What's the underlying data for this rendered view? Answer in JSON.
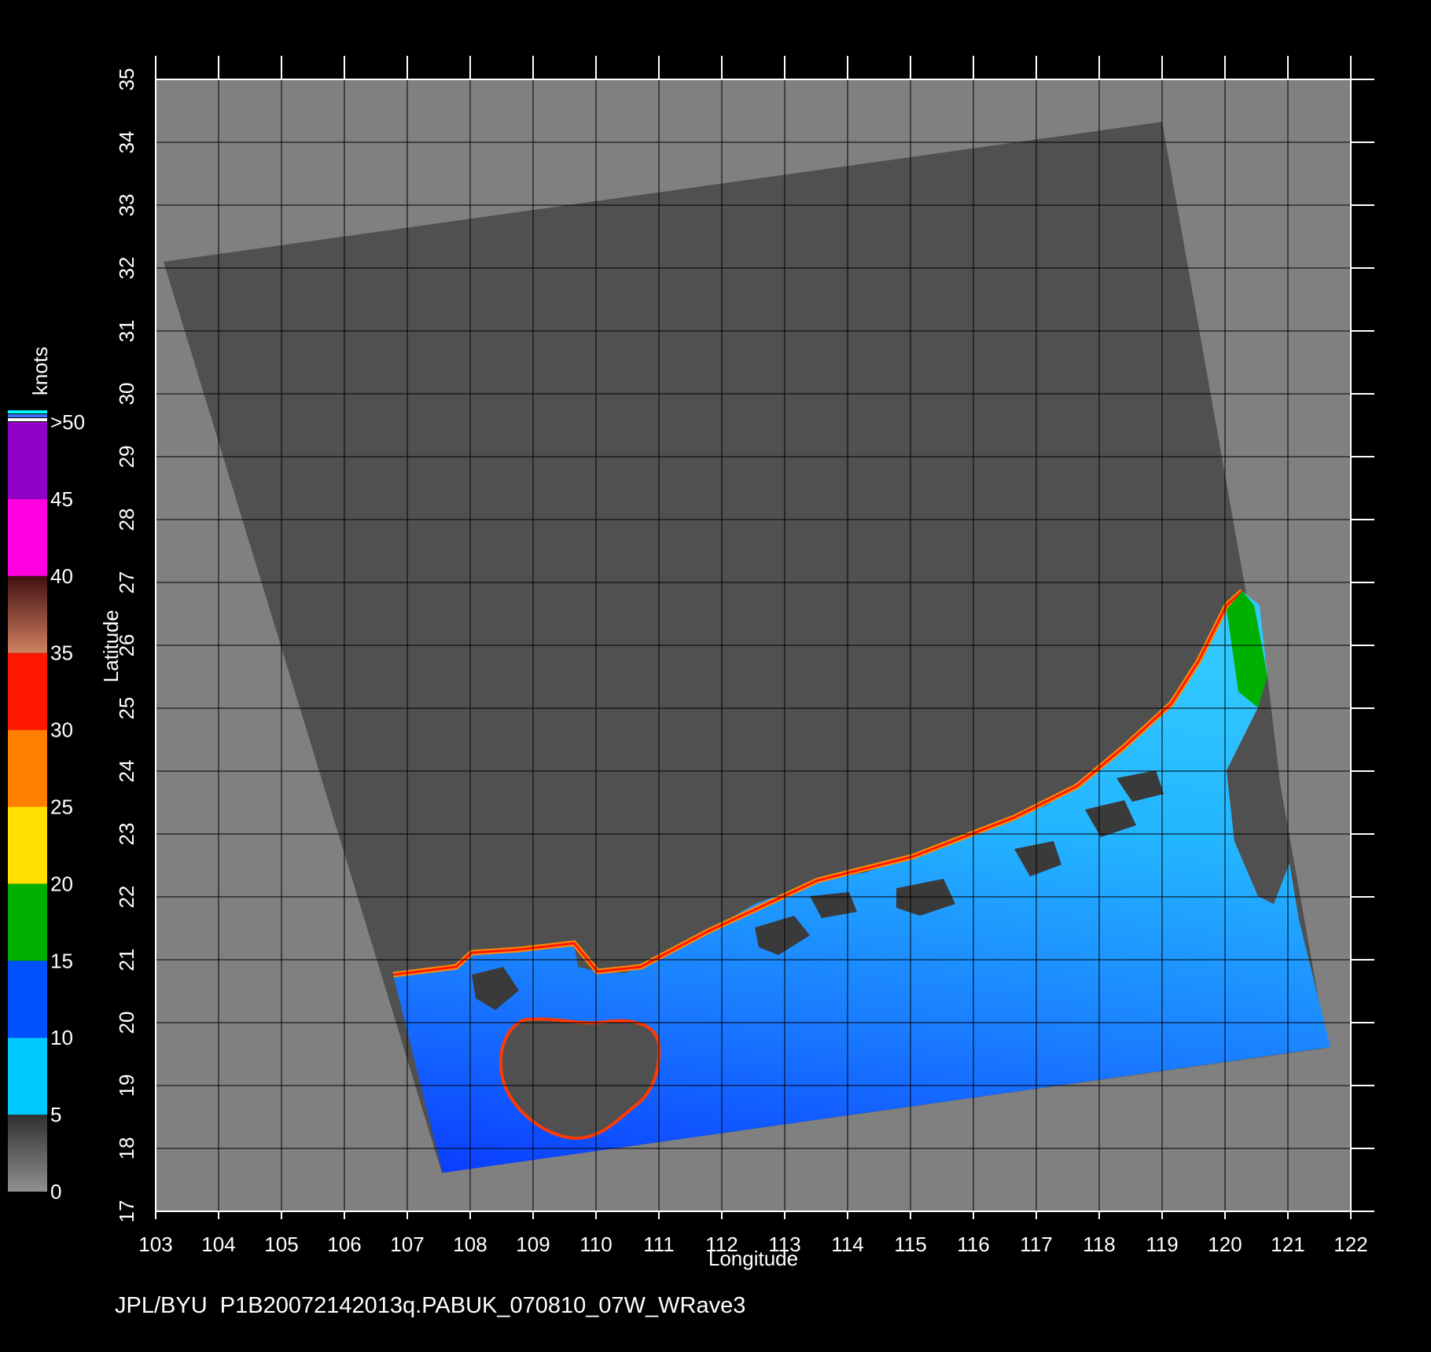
{
  "map": {
    "x_label": "Longitude",
    "y_label": "Latitude",
    "lon_ticks": [
      "103",
      "104",
      "105",
      "106",
      "107",
      "108",
      "109",
      "110",
      "111",
      "112",
      "113",
      "114",
      "115",
      "116",
      "117",
      "118",
      "119",
      "120",
      "121",
      "122"
    ],
    "lat_ticks": [
      "17",
      "18",
      "19",
      "20",
      "21",
      "22",
      "23",
      "24",
      "25",
      "26",
      "27",
      "28",
      "29",
      "30",
      "31",
      "32",
      "33",
      "34",
      "35"
    ],
    "lon_range": [
      103,
      122
    ],
    "lat_range": [
      17,
      35
    ],
    "background_color": "#808080",
    "swath_color": "#505050"
  },
  "colorbar": {
    "unit": "knots",
    "labels": [
      "0",
      "5",
      "10",
      "15",
      "20",
      "25",
      "30",
      "35",
      "40",
      "45",
      ">50"
    ],
    "bands": [
      {
        "from": 0,
        "to": 5,
        "color": "#606060"
      },
      {
        "from": 5,
        "to": 10,
        "color": "#00c8ff"
      },
      {
        "from": 10,
        "to": 15,
        "color": "#0050ff"
      },
      {
        "from": 15,
        "to": 20,
        "color": "#00b000"
      },
      {
        "from": 20,
        "to": 25,
        "color": "#ffe000"
      },
      {
        "from": 25,
        "to": 30,
        "color": "#ff8000"
      },
      {
        "from": 30,
        "to": 35,
        "color": "#ff1800"
      },
      {
        "from": 35,
        "to": 40,
        "color": "#8a3a20"
      },
      {
        "from": 40,
        "to": 45,
        "color": "#ff00e0"
      },
      {
        "from": 45,
        "to": 50,
        "color": "#9000c8"
      }
    ]
  },
  "footer": {
    "source": "JPL/BYU",
    "product": "P1B20072142013q.PABUK_070810_07W_WRave3"
  }
}
